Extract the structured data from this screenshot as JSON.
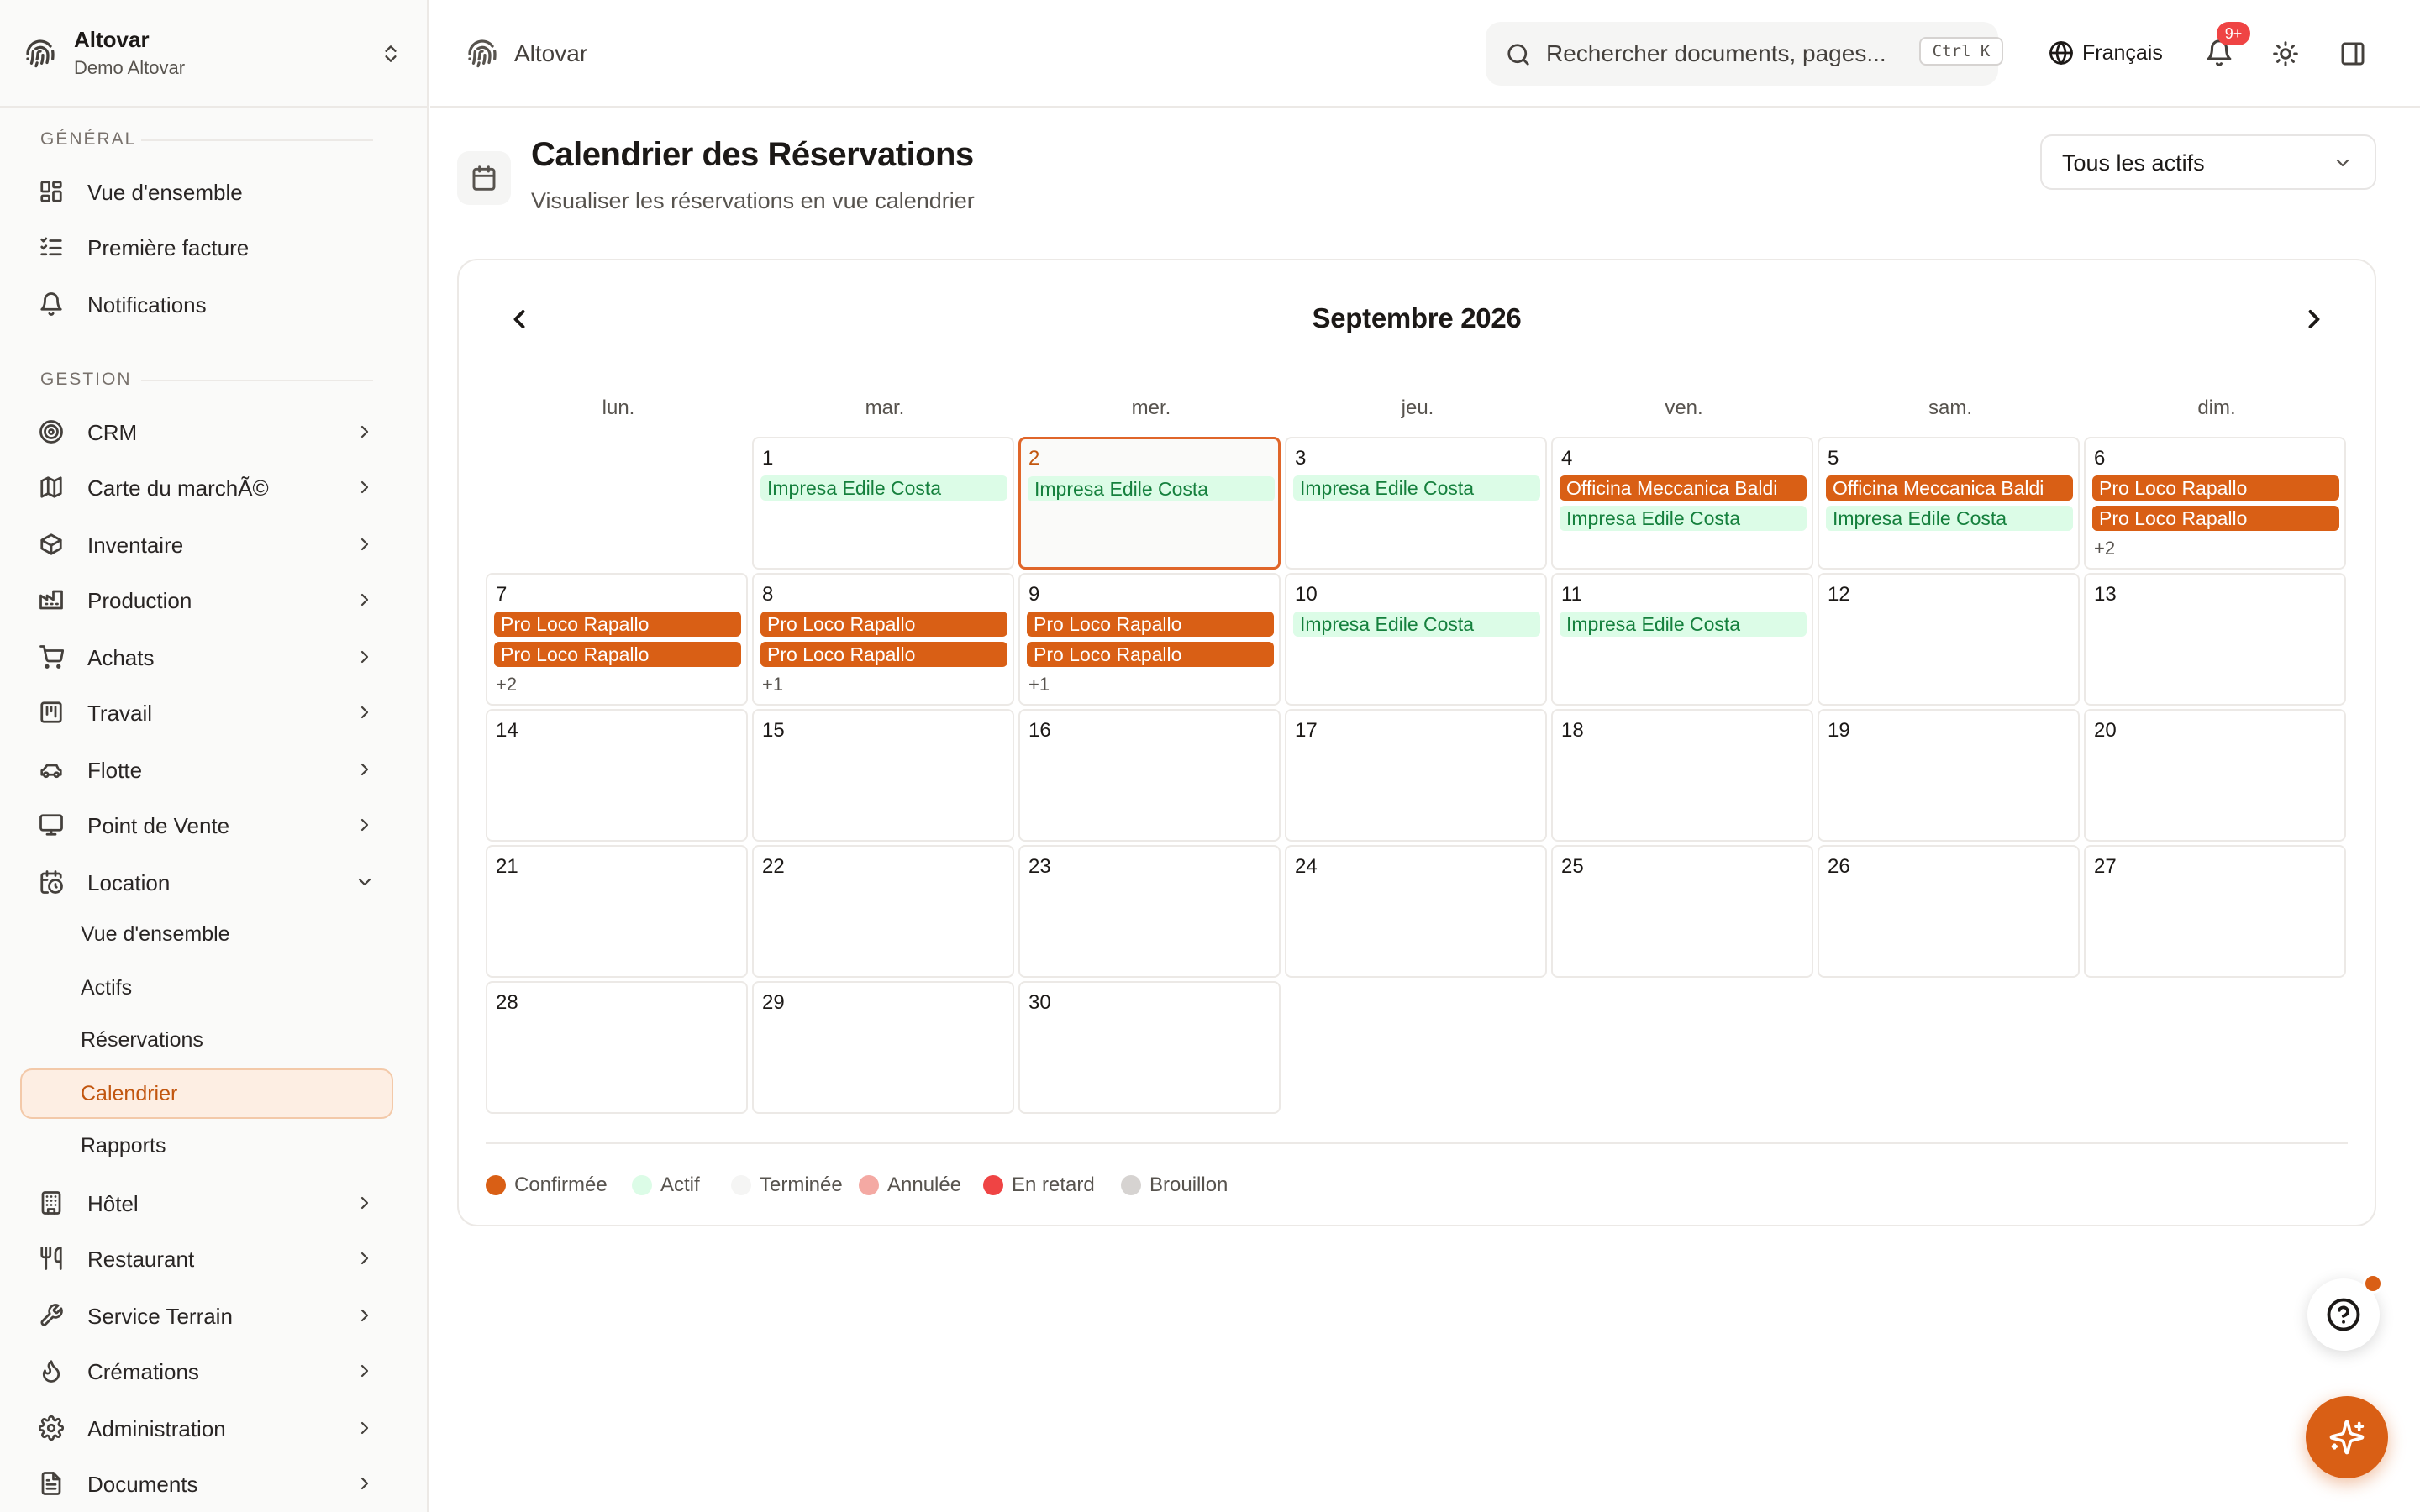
{
  "org": {
    "name": "Altovar",
    "subtitle": "Demo Altovar"
  },
  "sidebar": {
    "section_general": "GÉNÉRAL",
    "section_gestion": "GESTION",
    "general_items": [
      {
        "label": "Vue d'ensemble",
        "icon": "dashboard-icon"
      },
      {
        "label": "Première facture",
        "icon": "checklist-icon"
      },
      {
        "label": "Notifications",
        "icon": "bell-icon"
      }
    ],
    "gestion_items": [
      {
        "label": "CRM",
        "icon": "target-icon"
      },
      {
        "label": "Carte du marchÃ©",
        "icon": "map-icon"
      },
      {
        "label": "Inventaire",
        "icon": "package-icon"
      },
      {
        "label": "Production",
        "icon": "factory-icon"
      },
      {
        "label": "Achats",
        "icon": "cart-icon"
      },
      {
        "label": "Travail",
        "icon": "kanban-icon"
      },
      {
        "label": "Flotte",
        "icon": "car-icon"
      },
      {
        "label": "Point de Vente",
        "icon": "monitor-icon"
      },
      {
        "label": "Location",
        "icon": "calendar-clock-icon"
      }
    ],
    "location_sub": [
      {
        "label": "Vue d'ensemble"
      },
      {
        "label": "Actifs"
      },
      {
        "label": "Réservations"
      },
      {
        "label": "Calendrier"
      },
      {
        "label": "Rapports"
      }
    ],
    "more_items": [
      {
        "label": "Hôtel",
        "icon": "building-icon"
      },
      {
        "label": "Restaurant",
        "icon": "utensils-icon"
      },
      {
        "label": "Service Terrain",
        "icon": "wrench-icon"
      },
      {
        "label": "Crémations",
        "icon": "flame-icon"
      },
      {
        "label": "Administration",
        "icon": "gear-icon"
      },
      {
        "label": "Documents",
        "icon": "file-icon"
      }
    ]
  },
  "header": {
    "breadcrumb": "Altovar",
    "search_placeholder": "Rechercher documents, pages...",
    "search_shortcut": "Ctrl K",
    "language": "Français",
    "notif_badge": "9+"
  },
  "page": {
    "title": "Calendrier des Réservations",
    "subtitle": "Visualiser les réservations en vue calendrier",
    "asset_filter": "Tous les actifs"
  },
  "calendar": {
    "month_label": "Septembre 2026",
    "weekdays": [
      "lun.",
      "mar.",
      "mer.",
      "jeu.",
      "ven.",
      "sam.",
      "dim."
    ],
    "today": 2,
    "first_weekday_index": 1,
    "days_in_month": 30,
    "events": {
      "1": [
        {
          "label": "Impresa Edile Costa",
          "status": "active"
        }
      ],
      "2": [
        {
          "label": "Impresa Edile Costa",
          "status": "active"
        }
      ],
      "3": [
        {
          "label": "Impresa Edile Costa",
          "status": "active"
        }
      ],
      "4": [
        {
          "label": "Officina Meccanica Baldi",
          "status": "confirmed"
        },
        {
          "label": "Impresa Edile Costa",
          "status": "active"
        }
      ],
      "5": [
        {
          "label": "Officina Meccanica Baldi",
          "status": "confirmed"
        },
        {
          "label": "Impresa Edile Costa",
          "status": "active"
        }
      ],
      "6": [
        {
          "label": "Pro Loco Rapallo",
          "status": "confirmed"
        },
        {
          "label": "Pro Loco Rapallo",
          "status": "confirmed"
        }
      ],
      "7": [
        {
          "label": "Pro Loco Rapallo",
          "status": "confirmed"
        },
        {
          "label": "Pro Loco Rapallo",
          "status": "confirmed"
        }
      ],
      "8": [
        {
          "label": "Pro Loco Rapallo",
          "status": "confirmed"
        },
        {
          "label": "Pro Loco Rapallo",
          "status": "confirmed"
        }
      ],
      "9": [
        {
          "label": "Pro Loco Rapallo",
          "status": "confirmed"
        },
        {
          "label": "Pro Loco Rapallo",
          "status": "confirmed"
        }
      ],
      "10": [
        {
          "label": "Impresa Edile Costa",
          "status": "active"
        }
      ],
      "11": [
        {
          "label": "Impresa Edile Costa",
          "status": "active"
        }
      ]
    },
    "more": {
      "6": "+2",
      "7": "+2",
      "8": "+1",
      "9": "+1"
    }
  },
  "legend": [
    {
      "label": "Confirmée",
      "color": "#d95f15"
    },
    {
      "label": "Actif",
      "color": "#dcfce7"
    },
    {
      "label": "Terminée",
      "color": "#f5f5f4"
    },
    {
      "label": "Annulée",
      "color": "#f4a9a3"
    },
    {
      "label": "En retard",
      "color": "#ef4444"
    },
    {
      "label": "Brouillon",
      "color": "#d6d3d1"
    }
  ]
}
